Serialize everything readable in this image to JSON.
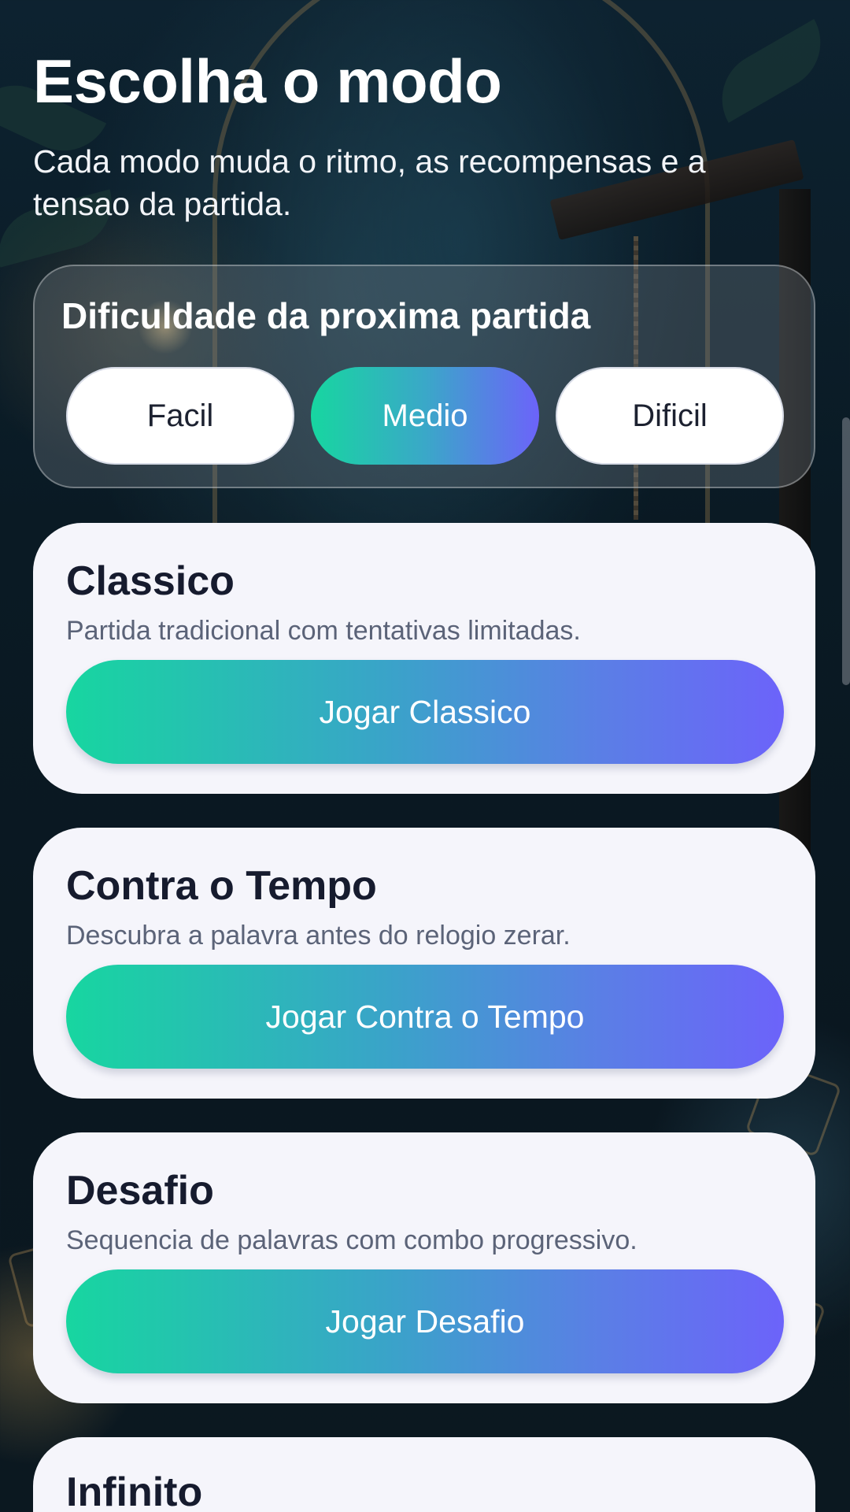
{
  "header": {
    "title": "Escolha o modo",
    "subtitle": "Cada modo muda o ritmo, as recompensas e a tensao da partida."
  },
  "difficulty": {
    "title": "Dificuldade da proxima partida",
    "options": [
      {
        "label": "Facil",
        "selected": false
      },
      {
        "label": "Medio",
        "selected": true
      },
      {
        "label": "Dificil",
        "selected": false
      }
    ]
  },
  "modes": [
    {
      "title": "Classico",
      "description": "Partida tradicional com tentativas limitadas.",
      "button": "Jogar Classico"
    },
    {
      "title": "Contra o Tempo",
      "description": "Descubra a palavra antes do relogio zerar.",
      "button": "Jogar Contra o Tempo"
    },
    {
      "title": "Desafio",
      "description": "Sequencia de palavras com combo progressivo.",
      "button": "Jogar Desafio"
    },
    {
      "title": "Infinito"
    }
  ],
  "colors": {
    "gradient_start": "#17d6a0",
    "gradient_end": "#6c63fa",
    "card_background": "#f5f5fb",
    "title_text": "#161b2e"
  }
}
